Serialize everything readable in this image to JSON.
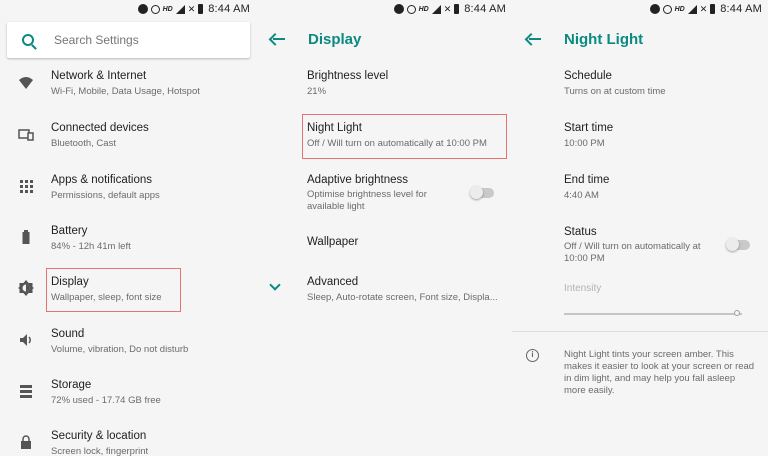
{
  "statusbar": {
    "time": "8:44 AM",
    "hd": "HD",
    "net": "4G"
  },
  "panel1": {
    "search": {
      "placeholder": "Search Settings"
    },
    "items": [
      {
        "title": "Network & Internet",
        "sub": "Wi-Fi, Mobile, Data Usage, Hotspot",
        "icon": "wifi-icon"
      },
      {
        "title": "Connected devices",
        "sub": "Bluetooth, Cast",
        "icon": "devices-icon"
      },
      {
        "title": "Apps & notifications",
        "sub": "Permissions, default apps",
        "icon": "apps-icon"
      },
      {
        "title": "Battery",
        "sub": "84% - 12h 41m left",
        "icon": "battery-icon"
      },
      {
        "title": "Display",
        "sub": "Wallpaper, sleep, font size",
        "icon": "brightness-icon"
      },
      {
        "title": "Sound",
        "sub": "Volume, vibration, Do not disturb",
        "icon": "volume-icon"
      },
      {
        "title": "Storage",
        "sub": "72% used - 17.74 GB free",
        "icon": "storage-icon"
      },
      {
        "title": "Security & location",
        "sub": "Screen lock, fingerprint",
        "icon": "lock-icon"
      }
    ]
  },
  "panel2": {
    "title": "Display",
    "items": [
      {
        "title": "Brightness level",
        "sub": "21%"
      },
      {
        "title": "Night Light",
        "sub": "Off / Will turn on automatically at 10:00 PM"
      },
      {
        "title": "Adaptive brightness",
        "sub1": "Optimise brightness level for",
        "sub2": "available light",
        "toggle": false
      },
      {
        "title": "Wallpaper"
      },
      {
        "title": "Advanced",
        "sub": "Sleep, Auto-rotate screen, Font size, Displa..."
      }
    ]
  },
  "panel3": {
    "title": "Night Light",
    "items": [
      {
        "title": "Schedule",
        "sub": "Turns on at custom time"
      },
      {
        "title": "Start time",
        "sub": "10:00 PM"
      },
      {
        "title": "End time",
        "sub": "4:40 AM"
      },
      {
        "title": "Status",
        "sub1": "Off / Will turn on automatically at",
        "sub2": "10:00 PM",
        "toggle": false
      }
    ],
    "intensity": {
      "label": "Intensity",
      "level": 0.97
    },
    "info": "Night Light tints your screen amber. This makes it easier to look at your screen or read in dim light, and may help you fall asleep more easily."
  },
  "colors": {
    "accent": "#0a8a80",
    "highlight": "#e57373"
  }
}
